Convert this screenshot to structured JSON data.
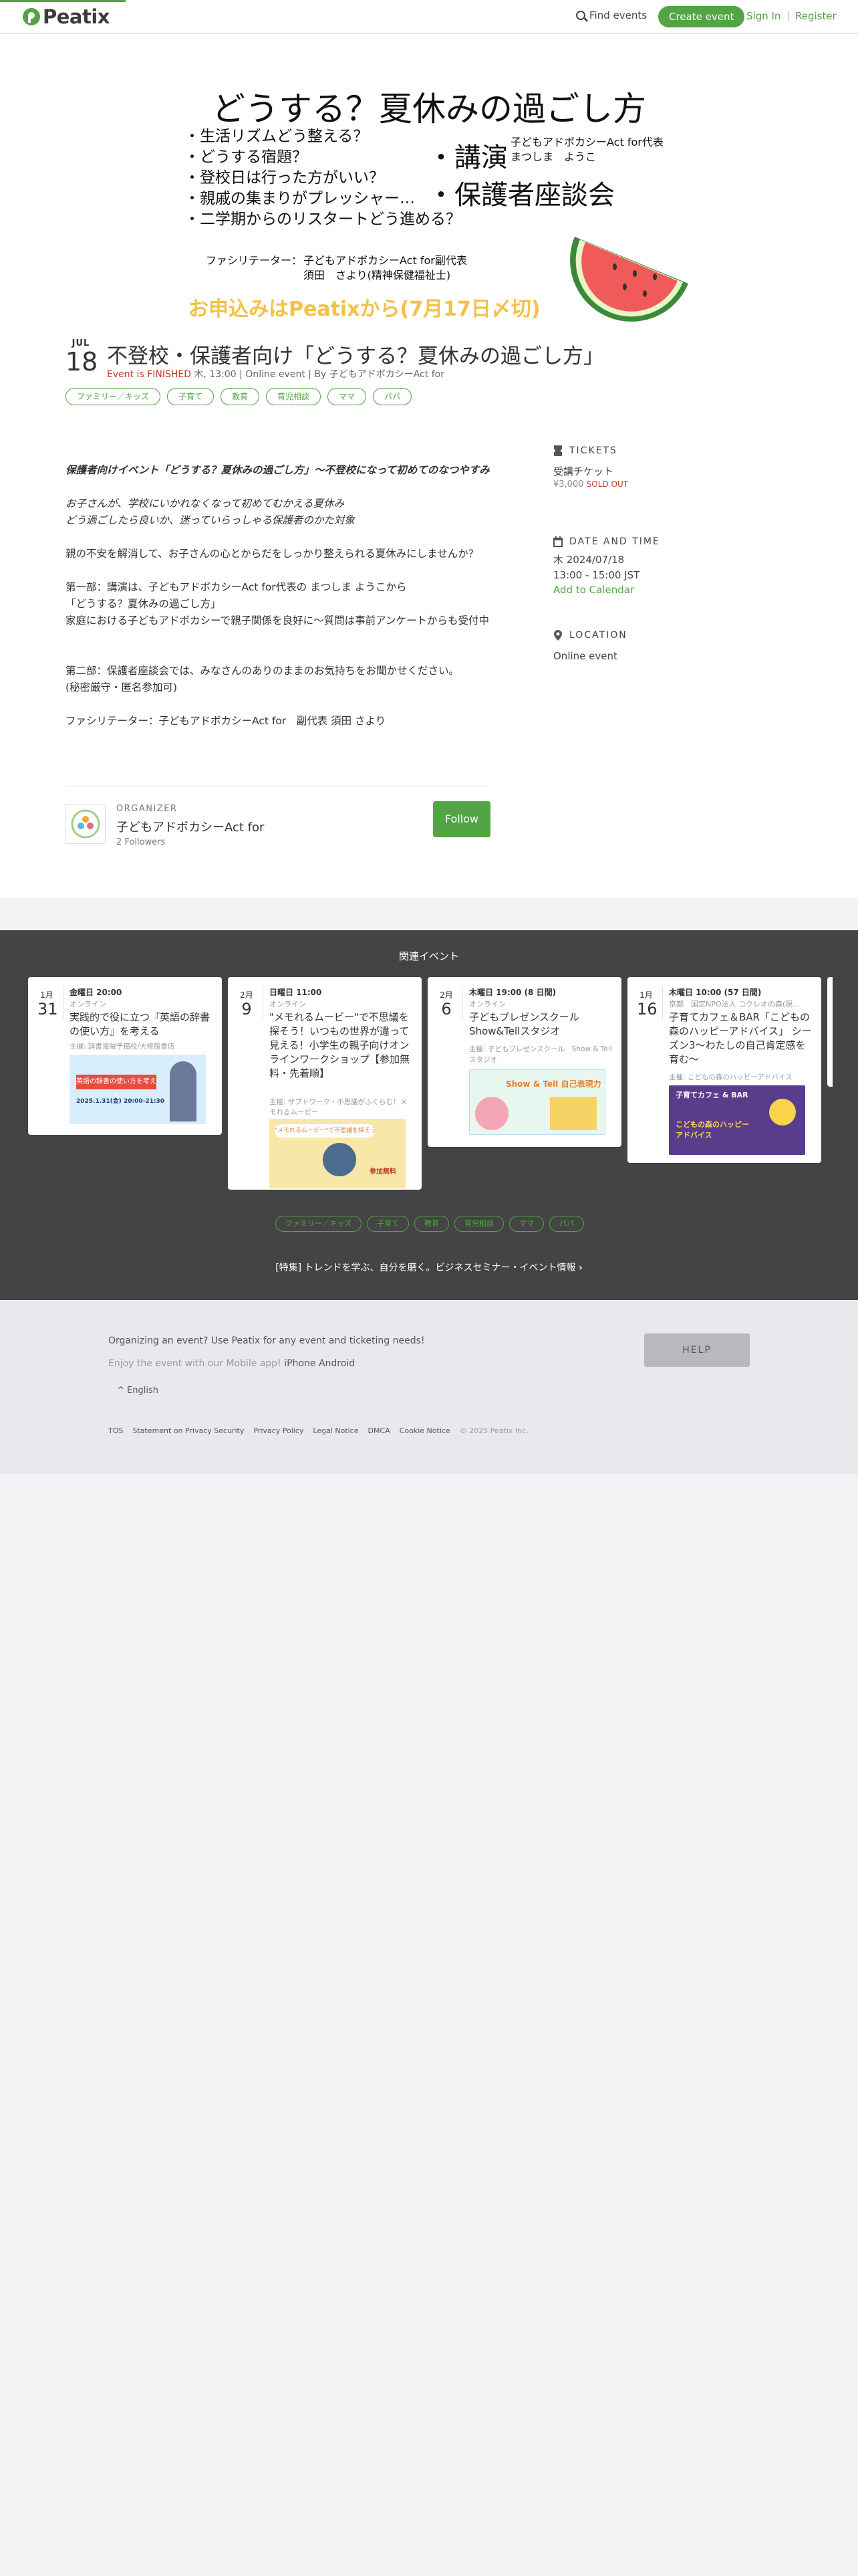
{
  "header": {
    "logo": "Peatix",
    "find_events": "Find events",
    "create_event": "Create event",
    "sign_in": "Sign In",
    "separator": "|",
    "register": "Register"
  },
  "banner": {
    "title": "どうする？夏休みの過ごし方",
    "list": [
      "・生活リズムどう整える？",
      "・どうする宿題？",
      "・登校日は行った方がいい？",
      "・親戚の集まりがプレッシャー…",
      "・二学期からのリスタートどう進める？"
    ],
    "lecture": "・講演",
    "lecture_speaker_1": "子どもアドボカシーAct for代表",
    "lecture_speaker_2": "まつしま　ようこ",
    "session": "・保護者座談会",
    "facilitator_label": "ファシリテーター：",
    "facilitator_1": "子どもアドボカシーAct for副代表",
    "facilitator_2": "須田　さより(精神保健福祉士)",
    "apply": "お申込みはPeatixから(7月17日〆切)"
  },
  "event": {
    "month": "JUL",
    "day": "18",
    "title": "不登校・保護者向け「どうする？夏休みの過ごし方」",
    "status": "Event is FINISHED",
    "meta": "木, 13:00 | Online event | By 子どもアドボカシーAct for",
    "tags": [
      "ファミリー／キッズ",
      "子育て",
      "教育",
      "育児相談",
      "ママ",
      "パパ"
    ]
  },
  "description": {
    "lead": "保護者向けイベント「どうする？夏休みの過ごし方」〜不登校になって初めてのなつやすみ",
    "it1": "お子さんが、学校にいかれなくなって初めてむかえる夏休み",
    "it2": "どう過ごしたら良いか、迷っていらっしゃる保護者のかた対象",
    "p1": "親の不安を解消して、お子さんの心とからだをしっかり整えられる夏休みにしませんか？",
    "p2a": "第一部：講演は、子どもアドボカシーAct for代表の まつしま ようこから",
    "p2b": "「どうする？夏休みの過ごし方」",
    "p2c": "家庭における子どもアドボカシーで親子関係を良好に〜質問は事前アンケートからも受付中",
    "p3a": "第二部：保護者座談会では、みなさんのありのままのお気持ちをお聞かせください。",
    "p3b": "(秘密厳守・匿名参加可)",
    "p4": "ファシリテーター：子どもアドボカシーAct for　副代表 須田 さより"
  },
  "organizer": {
    "label": "ORGANIZER",
    "name": "子どもアドボカシーAct for",
    "followers": "2 Followers",
    "follow": "Follow"
  },
  "sidebar": {
    "tickets_label": "TICKETS",
    "ticket_name": "受講チケット",
    "ticket_price": "¥3,000",
    "sold_out": "SOLD OUT",
    "datetime_label": "DATE AND TIME",
    "date": "木 2024/07/18",
    "time": "13:00 - 15:00 JST",
    "add_calendar": "Add to Calendar",
    "location_label": "LOCATION",
    "location": "Online event"
  },
  "related": {
    "title": "関連イベント",
    "cards": [
      {
        "month": "1月",
        "day": "31",
        "time": "金曜日 20:00",
        "place": "オンライン",
        "title": "実践的で役に立つ『英語の辞書の使い方』を考える",
        "host": "主催: 辞書海賊予備校/大修館書店",
        "thumb_text": "英語の辞書の使い方を考える",
        "thumb_sub": "2025.1.31(金) 20:00-21:30"
      },
      {
        "month": "2月",
        "day": "9",
        "time": "日曜日 11:00",
        "place": "オンライン",
        "title": "\"メモれるムービー\"で不思議を探そう！いつもの世界が違って見える！小学生の親子向けオンラインワークショップ【参加無料・先着順】",
        "host": "主催: ザブトワーク・不思議がふくらむ！メモれるムービー",
        "thumb_text": "\"メモれるムービー\"で不思議を探そう！",
        "thumb_sub": "参加無料"
      },
      {
        "month": "2月",
        "day": "6",
        "time": "木曜日 19:00 (8 日間)",
        "place": "オンライン",
        "title": "子どもプレゼンスクール Show&Tellスタジオ",
        "host": "主催: 子どもプレゼンスクール　Show & Tellスタジオ",
        "thumb_text": "Show & Tell 自己表現力",
        "thumb_sub": ""
      },
      {
        "month": "1月",
        "day": "16",
        "time": "木曜日 10:00 (57 日間)",
        "place": "京都　国定NPO法人 コクレオの森(現…",
        "title": "子育てカフェ＆BAR「こどもの森のハッピーアドバイス」 シーズン3〜わたしの自己肯定感を育む〜",
        "host": "主催: こどもの森のハッピーアドバイス",
        "thumb_text": "子育てカフェ & BAR",
        "thumb_sub": "こどもの森のハッピーアドバイス"
      }
    ],
    "tags": [
      "ファミリー／キッズ",
      "子育て",
      "教育",
      "育児相談",
      "ママ",
      "パパ"
    ],
    "tokushu": "[特集] トレンドを学ぶ、自分を磨く。ビジネスセミナー・イベント情報"
  },
  "footer": {
    "organizing": "Organizing an event? Use Peatix for any event and ticketing needs!",
    "mobile": "Enjoy the event with our Mobile app!",
    "iphone": "iPhone",
    "android": "Android",
    "language": "English",
    "help": "HELP",
    "links": [
      "TOS",
      "Statement on Privacy Security",
      "Privacy Policy",
      "Legal Notice",
      "DMCA",
      "Cookie Notice"
    ],
    "copyright": "© 2025 Peatix Inc."
  },
  "colors": {
    "brand": "#52a445",
    "finished": "#c0392b",
    "related_bg": "#444444",
    "banner_yellow": "#f3c146"
  }
}
